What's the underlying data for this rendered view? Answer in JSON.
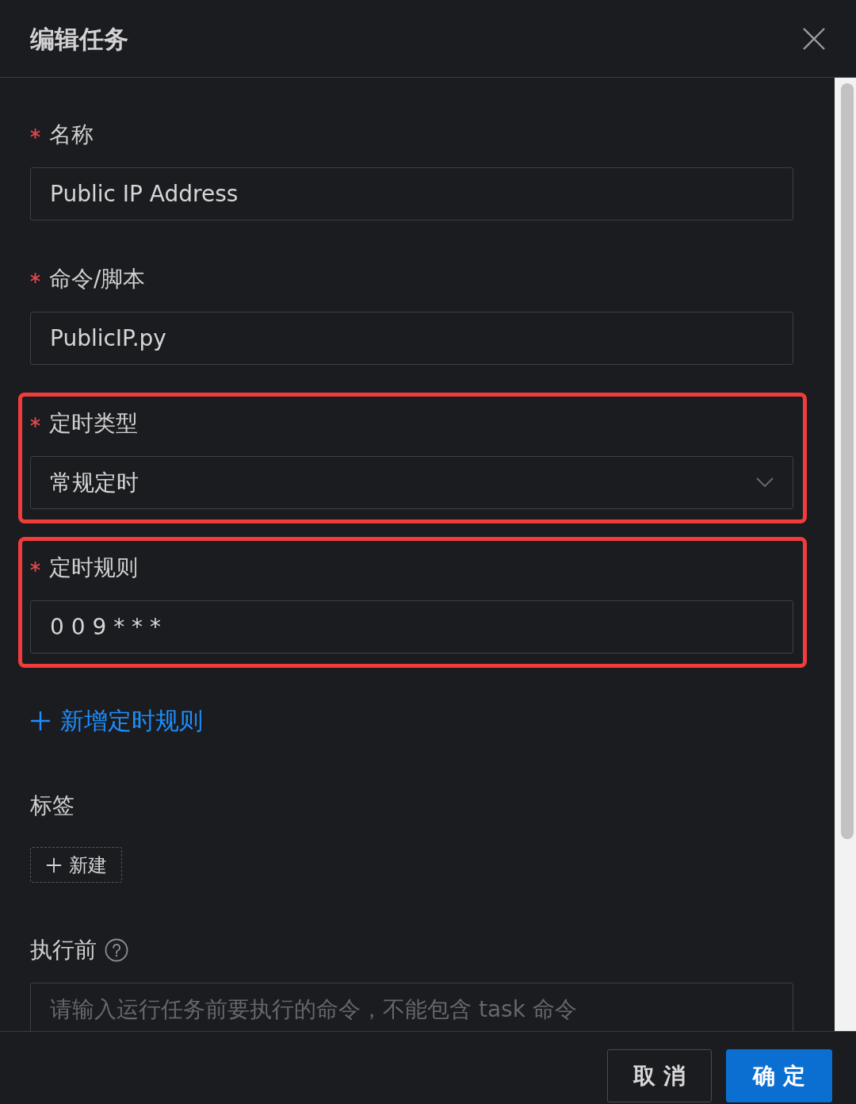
{
  "dialog": {
    "title": "编辑任务"
  },
  "fields": [
    {
      "kind": "input",
      "label": "名称",
      "required": true,
      "value": "Public IP Address",
      "highlighted": false
    },
    {
      "kind": "input",
      "label": "命令/脚本",
      "required": true,
      "value": "PublicIP.py",
      "highlighted": false
    },
    {
      "kind": "select",
      "label": "定时类型",
      "required": true,
      "value": "常规定时",
      "highlighted": true
    },
    {
      "kind": "input",
      "label": "定时规则",
      "required": true,
      "value": "0 0 9 * * *",
      "highlighted": true
    },
    {
      "kind": "add_link",
      "text": "新增定时规则"
    },
    {
      "kind": "tags",
      "label": "标签",
      "required": false,
      "add_button": "新建"
    },
    {
      "kind": "input",
      "label": "执行前",
      "required": false,
      "help": true,
      "placeholder": "请输入运行任务前要执行的命令，不能包含 task 命令",
      "highlighted": false
    }
  ],
  "footer": {
    "buttons": [
      {
        "label": "取 消",
        "primary": false
      },
      {
        "label": "确 定",
        "primary": true
      }
    ]
  }
}
